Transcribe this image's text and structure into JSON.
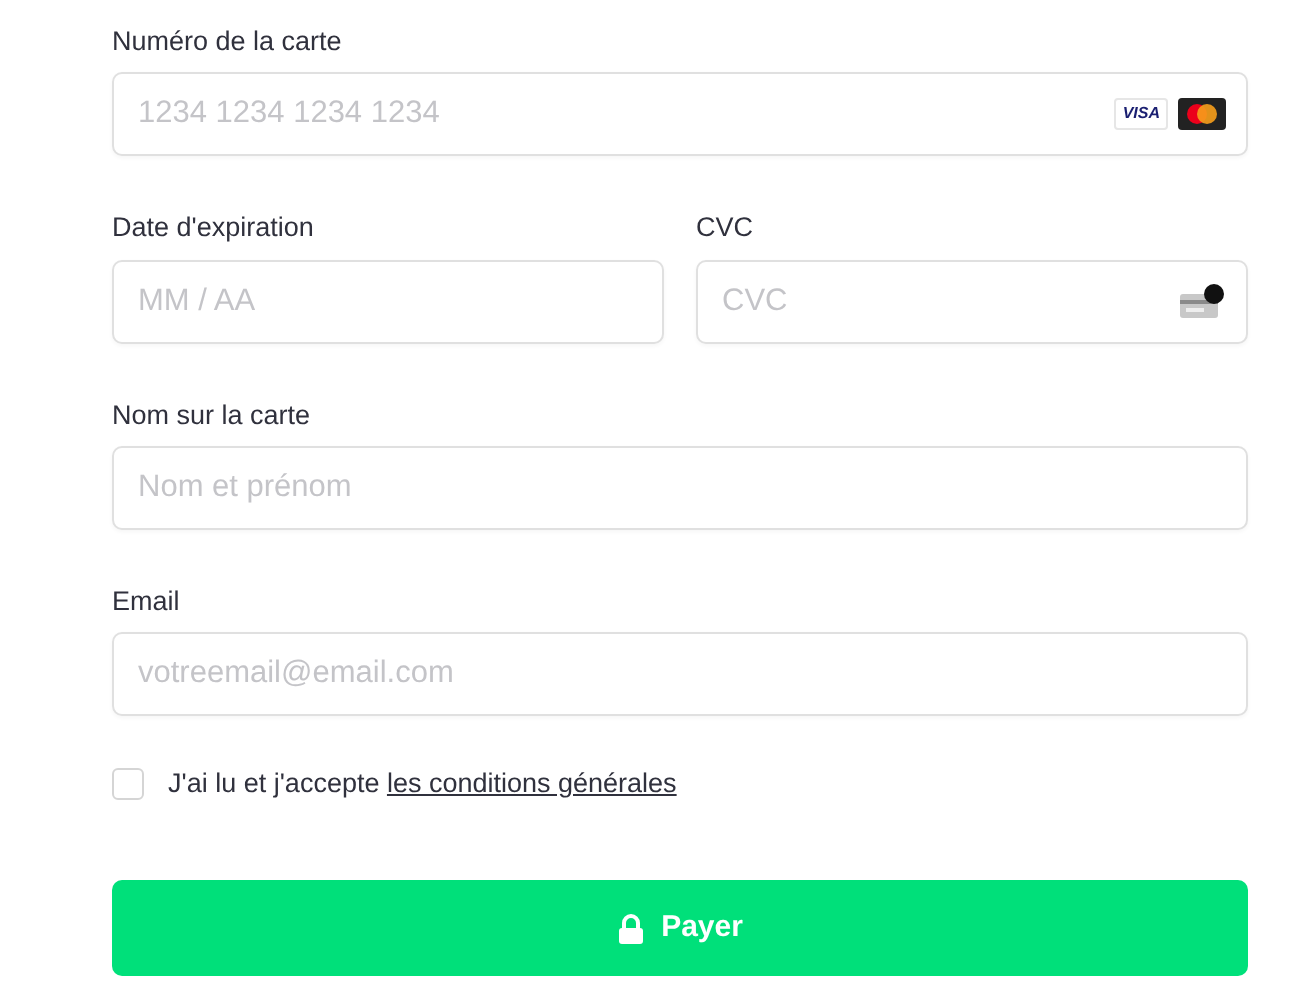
{
  "card_number": {
    "label": "Numéro de la carte",
    "placeholder": "1234 1234 1234 1234",
    "brand": "VISA"
  },
  "expiry": {
    "label": "Date d'expiration",
    "placeholder": "MM / AA"
  },
  "cvc": {
    "label": "CVC",
    "placeholder": "CVC"
  },
  "name": {
    "label": "Nom sur la carte",
    "placeholder": "Nom et prénom"
  },
  "email": {
    "label": "Email",
    "placeholder": "votreemail@email.com"
  },
  "terms": {
    "checked": false,
    "text": "J'ai lu et j'accepte",
    "link": "les conditions générales"
  },
  "pay_button": {
    "label": "Payer"
  }
}
